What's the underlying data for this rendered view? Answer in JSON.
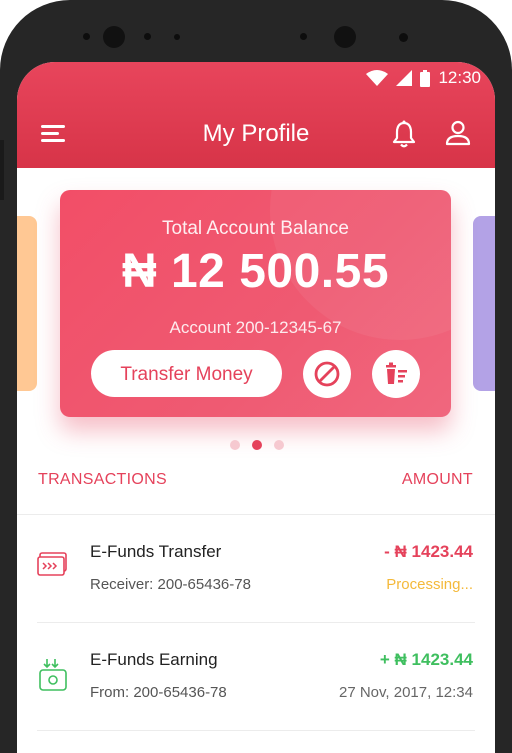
{
  "status_bar": {
    "time": "12:30",
    "wifi_icon": "wifi-icon",
    "signal_icon": "signal-icon",
    "battery_icon": "battery-icon"
  },
  "header": {
    "title": "My Profile",
    "menu_icon": "menu-icon",
    "notification_icon": "bell-icon",
    "profile_icon": "user-icon"
  },
  "balance_card": {
    "label": "Total Account Balance",
    "balance": "₦ 12 500.55",
    "account": "Account 200-12345-67",
    "transfer_label": "Transfer Money",
    "block_icon": "block-icon",
    "delete_icon": "trash-icon"
  },
  "carousel": {
    "count": 3,
    "active_index": 1
  },
  "transactions": {
    "header_left": "TRANSACTIONS",
    "header_right": "AMOUNT",
    "items": [
      {
        "title": "E-Funds Transfer",
        "subtitle": "Receiver: 200-65436-78",
        "amount": "- ₦ 1423.44",
        "status": "Processing...",
        "icon": "transfer-icon",
        "amount_color": "#e5425b",
        "status_color": "#f4b93a"
      },
      {
        "title": "E-Funds Earning",
        "subtitle": "From: 200-65436-78",
        "amount": "+ ₦ 1423.44",
        "status": "27 Nov, 2017, 12:34",
        "icon": "earning-icon",
        "amount_color": "#3fbf5f",
        "status_color": "#666666"
      }
    ]
  },
  "colors": {
    "accent": "#e5425b",
    "header": "#d73448",
    "success": "#3fbf5f",
    "warning": "#f4b93a"
  }
}
